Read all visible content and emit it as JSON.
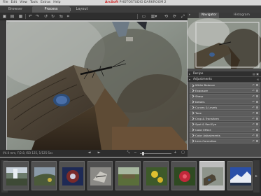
{
  "menu": {
    "items": [
      "File",
      "Edit",
      "View",
      "Tools",
      "Extras",
      "Help"
    ],
    "title_brand": "ArcSoft",
    "title_rest": "PHOTOSTUDIO DARKROOM 2"
  },
  "tabs": {
    "browse": "Browser",
    "process": "Process",
    "layout": "Layout"
  },
  "status": {
    "text": "f/4.0 mm, F/2.8, ISO 125, 1/125 Sec"
  },
  "navigator": {
    "tab_active": "Navigator",
    "tab_other": "Histogram"
  },
  "sections": {
    "recipe": "Recipe",
    "adjustments": "Adjustments"
  },
  "adjustments": [
    "White Balance",
    "Exposure",
    "Sharp",
    "Details",
    "Curves & Levels",
    "Tone",
    "Crop & Transform",
    "Spot & Red Eye",
    "Color Effect",
    "Color Adjustments",
    "Lens Correction"
  ],
  "colors": {
    "accent": "#cc2222",
    "panel": "#4a4a4a",
    "dark": "#2a2a2a"
  }
}
